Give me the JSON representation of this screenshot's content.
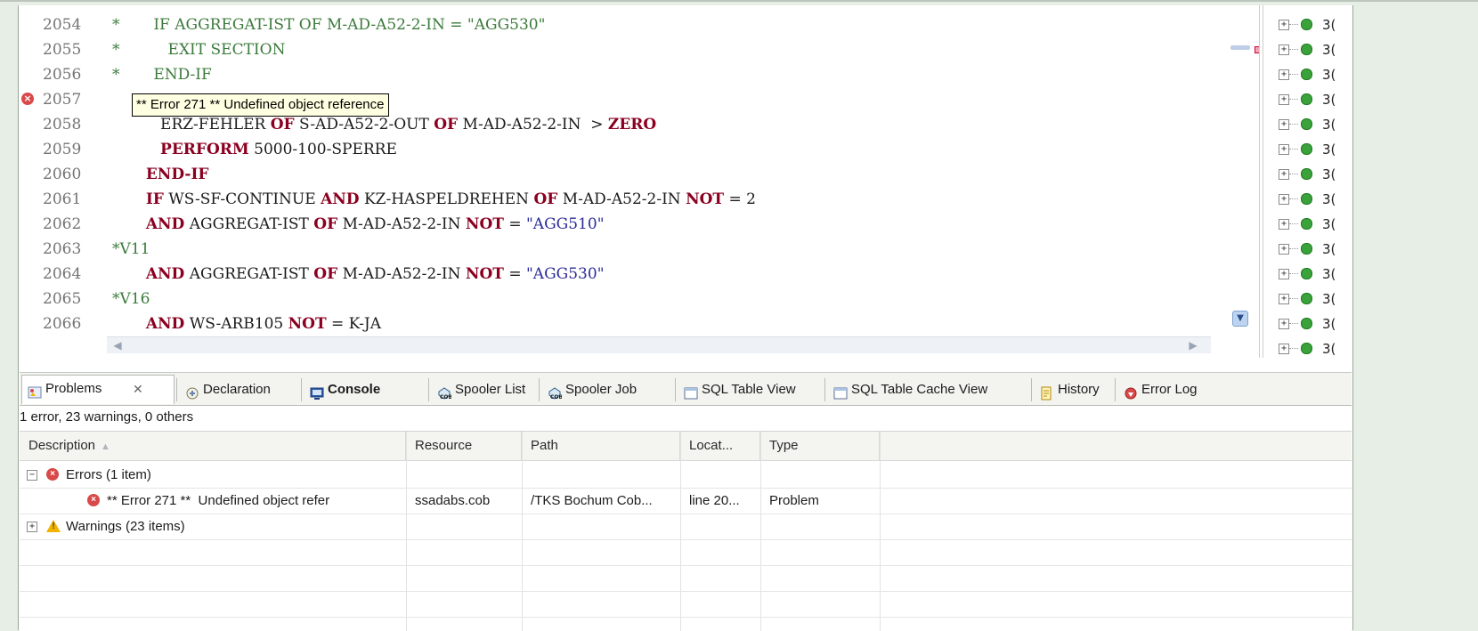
{
  "editor": {
    "lines": [
      {
        "num": "2054",
        "mark": "",
        "segments": [
          {
            "t": "*",
            "c": "cmt"
          },
          {
            "t": "       IF AGGREGAT-IST OF M-AD-A52-2-IN = \"AGG530\"",
            "c": "cmt"
          }
        ]
      },
      {
        "num": "2055",
        "mark": "",
        "segments": [
          {
            "t": "*",
            "c": "cmt"
          },
          {
            "t": "          EXIT SECTION",
            "c": "cmt"
          }
        ]
      },
      {
        "num": "2056",
        "mark": "",
        "segments": [
          {
            "t": "*",
            "c": "cmt"
          },
          {
            "t": "       END-IF",
            "c": "cmt"
          }
        ]
      },
      {
        "num": "2057",
        "mark": "error",
        "segments": []
      },
      {
        "num": "2058",
        "mark": "",
        "segments": [
          {
            "t": "          ERZ-FEHLER ",
            "c": ""
          },
          {
            "t": "OF",
            "c": "kw"
          },
          {
            "t": " S-AD-A52-2-OUT ",
            "c": ""
          },
          {
            "t": "OF",
            "c": "kw"
          },
          {
            "t": " M-AD-A52-2-IN  > ",
            "c": ""
          },
          {
            "t": "ZERO",
            "c": "kw"
          }
        ]
      },
      {
        "num": "2059",
        "mark": "",
        "segments": [
          {
            "t": "          ",
            "c": ""
          },
          {
            "t": "PERFORM",
            "c": "kw"
          },
          {
            "t": " 5000-100-SPERRE",
            "c": ""
          }
        ]
      },
      {
        "num": "2060",
        "mark": "",
        "segments": [
          {
            "t": "       ",
            "c": ""
          },
          {
            "t": "END-IF",
            "c": "kw"
          }
        ]
      },
      {
        "num": "2061",
        "mark": "",
        "segments": [
          {
            "t": "       ",
            "c": ""
          },
          {
            "t": "IF",
            "c": "kw"
          },
          {
            "t": " WS-SF-CONTINUE ",
            "c": ""
          },
          {
            "t": "AND",
            "c": "kw"
          },
          {
            "t": " KZ-HASPELDREHEN ",
            "c": ""
          },
          {
            "t": "OF",
            "c": "kw"
          },
          {
            "t": " M-AD-A52-2-IN ",
            "c": ""
          },
          {
            "t": "NOT",
            "c": "kw"
          },
          {
            "t": " = 2",
            "c": ""
          }
        ]
      },
      {
        "num": "2062",
        "mark": "",
        "segments": [
          {
            "t": "       ",
            "c": ""
          },
          {
            "t": "AND",
            "c": "kw"
          },
          {
            "t": " AGGREGAT-IST ",
            "c": ""
          },
          {
            "t": "OF",
            "c": "kw"
          },
          {
            "t": " M-AD-A52-2-IN ",
            "c": ""
          },
          {
            "t": "NOT",
            "c": "kw"
          },
          {
            "t": " = ",
            "c": ""
          },
          {
            "t": "\"AGG510\"",
            "c": "str"
          }
        ]
      },
      {
        "num": "2063",
        "mark": "",
        "segments": [
          {
            "t": "*V11",
            "c": "cmt"
          }
        ]
      },
      {
        "num": "2064",
        "mark": "",
        "segments": [
          {
            "t": "       ",
            "c": ""
          },
          {
            "t": "AND",
            "c": "kw"
          },
          {
            "t": " AGGREGAT-IST ",
            "c": ""
          },
          {
            "t": "OF",
            "c": "kw"
          },
          {
            "t": " M-AD-A52-2-IN ",
            "c": ""
          },
          {
            "t": "NOT",
            "c": "kw"
          },
          {
            "t": " = ",
            "c": ""
          },
          {
            "t": "\"AGG530\"",
            "c": "str"
          }
        ]
      },
      {
        "num": "2065",
        "mark": "",
        "segments": [
          {
            "t": "*V16",
            "c": "cmt"
          }
        ]
      },
      {
        "num": "2066",
        "mark": "",
        "segments": [
          {
            "t": "       ",
            "c": ""
          },
          {
            "t": "AND",
            "c": "kw"
          },
          {
            "t": " WS-ARB105 ",
            "c": ""
          },
          {
            "t": "NOT",
            "c": "kw"
          },
          {
            "t": " = K-JA",
            "c": ""
          }
        ]
      }
    ],
    "tooltip": "** Error 271 ** Undefined object reference"
  },
  "outline": {
    "row_count": 14,
    "item_text": "3("
  },
  "tabs": [
    {
      "label": "Problems",
      "icon": "problems-icon",
      "active": true,
      "closable": true,
      "bold": false
    },
    {
      "label": "Declaration",
      "icon": "declaration-icon",
      "active": false,
      "closable": false,
      "bold": false
    },
    {
      "label": "Console",
      "icon": "console-icon",
      "active": false,
      "closable": false,
      "bold": true
    },
    {
      "label": "Spooler List",
      "icon": "cob-icon",
      "active": false,
      "closable": false,
      "bold": false
    },
    {
      "label": "Spooler Job",
      "icon": "cob-icon",
      "active": false,
      "closable": false,
      "bold": false
    },
    {
      "label": "SQL Table View",
      "icon": "table-icon",
      "active": false,
      "closable": false,
      "bold": false
    },
    {
      "label": "SQL Table Cache View",
      "icon": "table-icon",
      "active": false,
      "closable": false,
      "bold": false
    },
    {
      "label": "History",
      "icon": "history-icon",
      "active": false,
      "closable": false,
      "bold": false
    },
    {
      "label": "Error Log",
      "icon": "error-log-icon",
      "active": false,
      "closable": false,
      "bold": false
    }
  ],
  "problems": {
    "summary": "1 error, 23 warnings, 0 others",
    "columns": [
      "Description",
      "Resource",
      "Path",
      "Locat...",
      "Type"
    ],
    "rows": [
      {
        "kind": "group-error",
        "expander": "−",
        "description": "Errors (1 item)",
        "resource": "",
        "path": "",
        "location": "",
        "type": ""
      },
      {
        "kind": "item-error",
        "expander": "",
        "description": "** Error 271 **  Undefined object refer",
        "resource": "ssadabs.cob",
        "path": "/TKS Bochum Cob...",
        "location": "line 20...",
        "type": "Problem"
      },
      {
        "kind": "group-warn",
        "expander": "+",
        "description": "Warnings (23 items)",
        "resource": "",
        "path": "",
        "location": "",
        "type": ""
      }
    ]
  },
  "colors": {
    "keyword": "#8b0020",
    "string": "#2a2a9a",
    "comment": "#3b7a3b",
    "error": "#d84a4a",
    "warning": "#f0b400"
  }
}
